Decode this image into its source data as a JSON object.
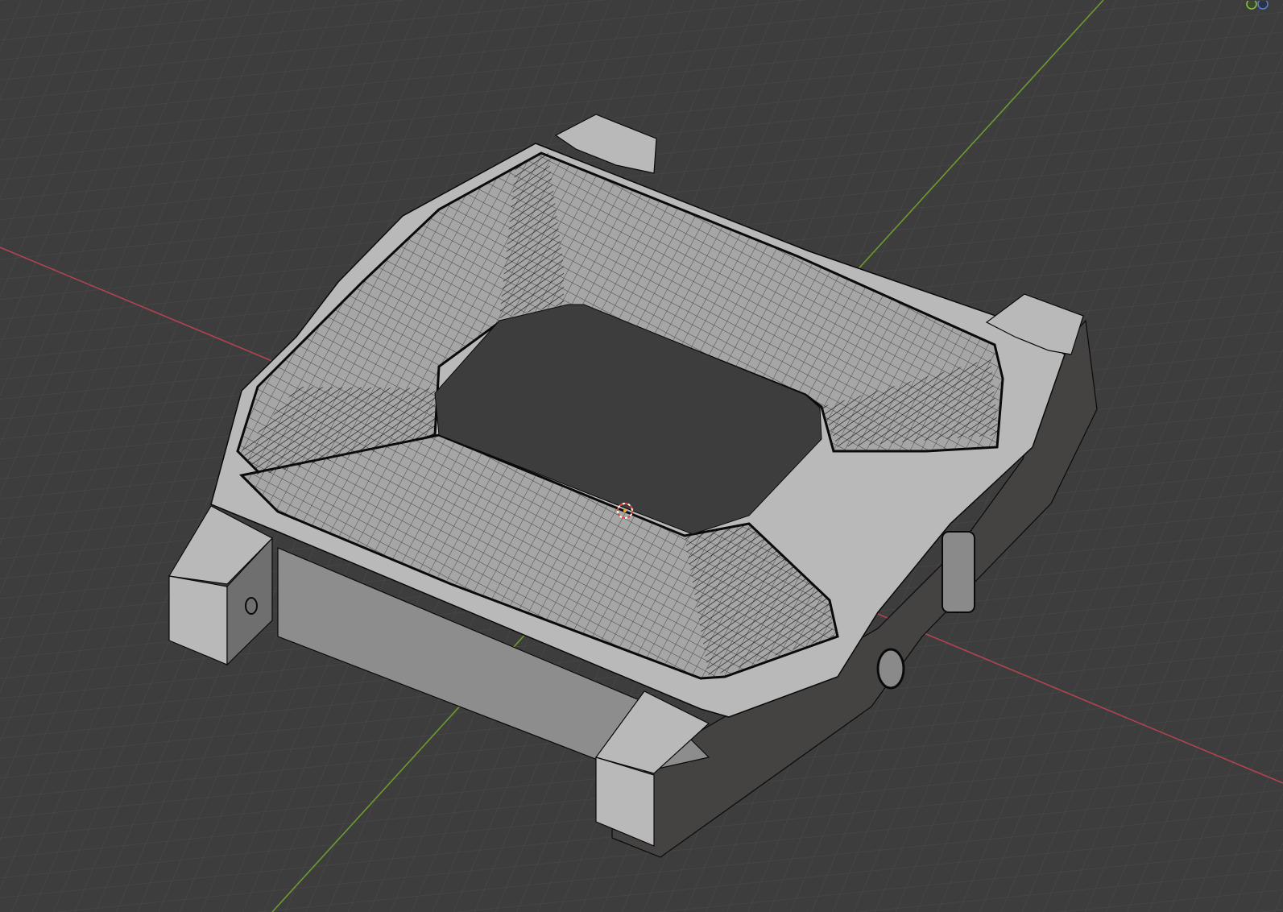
{
  "app": {
    "name": "",
    "mode": "edit-mode",
    "shading": "solid-with-wireframe-overlay"
  },
  "viewport": {
    "background": "#3d3d3d",
    "grid_color": "#4a4a4a",
    "axis_x_color": "#b3434f",
    "axis_y_color": "#6e9a2e",
    "mesh_light": "#b9b9b9",
    "mesh_mid": "#9b9b9b",
    "mesh_dark": "#454242",
    "wire_color": "#0a0a0a",
    "cursor_colors": [
      "#e04b3b",
      "#ffffff"
    ]
  },
  "gizmo": {
    "items": [
      "navigation-gizmo-x",
      "navigation-gizmo-y"
    ]
  },
  "object": {
    "name": "",
    "selected": true
  }
}
